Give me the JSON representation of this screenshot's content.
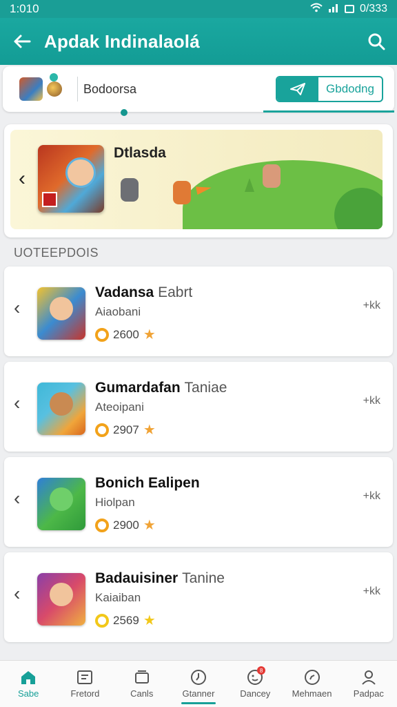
{
  "status_bar": {
    "time": "1:010",
    "right_text": "0/333"
  },
  "app_bar": {
    "title": "Apdak Indinalaolá"
  },
  "filter_bar": {
    "label": "Bodoorsa",
    "toggle_label": "Gbdodng"
  },
  "banner": {
    "title": "Dtlasda"
  },
  "section": {
    "header": "UOTEEPDOIS"
  },
  "list": [
    {
      "title": "Vadansa",
      "title_suffix": "Eabrt",
      "subtitle": "Aiaobani",
      "rating": "2600",
      "right": "+kk"
    },
    {
      "title": "Gumardafan",
      "title_suffix": "Taniae",
      "subtitle": "Ateoipani",
      "rating": "2907",
      "right": "+kk"
    },
    {
      "title": "Bonich Ealipen",
      "title_suffix": "",
      "subtitle": "Hiolpan",
      "rating": "2900",
      "right": "+kk"
    },
    {
      "title": "Badauisiner",
      "title_suffix": "Tanine",
      "subtitle": "Kaiaiban",
      "rating": "2569",
      "right": "+kk"
    }
  ],
  "bottom_nav": [
    {
      "label": "Sabe",
      "icon": "home-icon"
    },
    {
      "label": "Fretord",
      "icon": "document-icon"
    },
    {
      "label": "Canls",
      "icon": "cards-icon"
    },
    {
      "label": "Gtanner",
      "icon": "clock-icon"
    },
    {
      "label": "Dancey",
      "icon": "face-icon",
      "badge": "8"
    },
    {
      "label": "Mehmaen",
      "icon": "compass-icon"
    },
    {
      "label": "Padpac",
      "icon": "profile-icon"
    }
  ],
  "colors": {
    "primary": "#19a39b",
    "star": "#f0a336",
    "coin": "#f2a21a"
  }
}
